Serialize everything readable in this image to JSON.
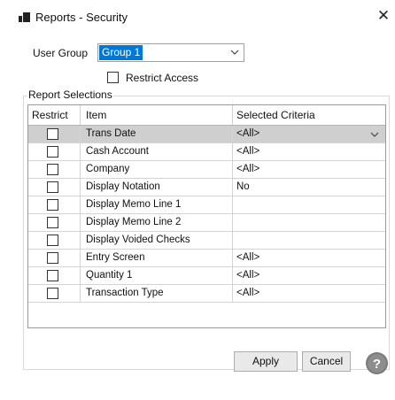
{
  "window": {
    "title": "Reports - Security",
    "close_glyph": "✕"
  },
  "user_group": {
    "label": "User Group",
    "value": "Group 1"
  },
  "restrict_access": {
    "label": "Restrict Access",
    "checked": false
  },
  "report_selections": {
    "legend": "Report Selections",
    "columns": [
      "Restrict",
      "Item",
      "Selected Criteria"
    ],
    "rows": [
      {
        "restrict": false,
        "item": "Trans Date",
        "criteria": "<All>",
        "selected": true
      },
      {
        "restrict": false,
        "item": "Cash Account",
        "criteria": "<All>",
        "selected": false
      },
      {
        "restrict": false,
        "item": "Company",
        "criteria": "<All>",
        "selected": false
      },
      {
        "restrict": false,
        "item": "Display Notation",
        "criteria": "No",
        "selected": false
      },
      {
        "restrict": false,
        "item": "Display Memo Line 1",
        "criteria": "",
        "selected": false
      },
      {
        "restrict": false,
        "item": "Display Memo Line 2",
        "criteria": "",
        "selected": false
      },
      {
        "restrict": false,
        "item": "Display Voided Checks",
        "criteria": "",
        "selected": false
      },
      {
        "restrict": false,
        "item": "Entry Screen",
        "criteria": "<All>",
        "selected": false
      },
      {
        "restrict": false,
        "item": "Quantity 1",
        "criteria": "<All>",
        "selected": false
      },
      {
        "restrict": false,
        "item": "Transaction Type",
        "criteria": "<All>",
        "selected": false
      }
    ]
  },
  "buttons": {
    "apply": "Apply",
    "cancel": "Cancel"
  },
  "icons": {
    "app": "report-icon",
    "help": "help-icon",
    "dropdown": "chevron-down-icon"
  },
  "colors": {
    "selection": "#0078d7",
    "selected_row": "#cfcfcf",
    "help_icon": "#7a7a7a"
  }
}
